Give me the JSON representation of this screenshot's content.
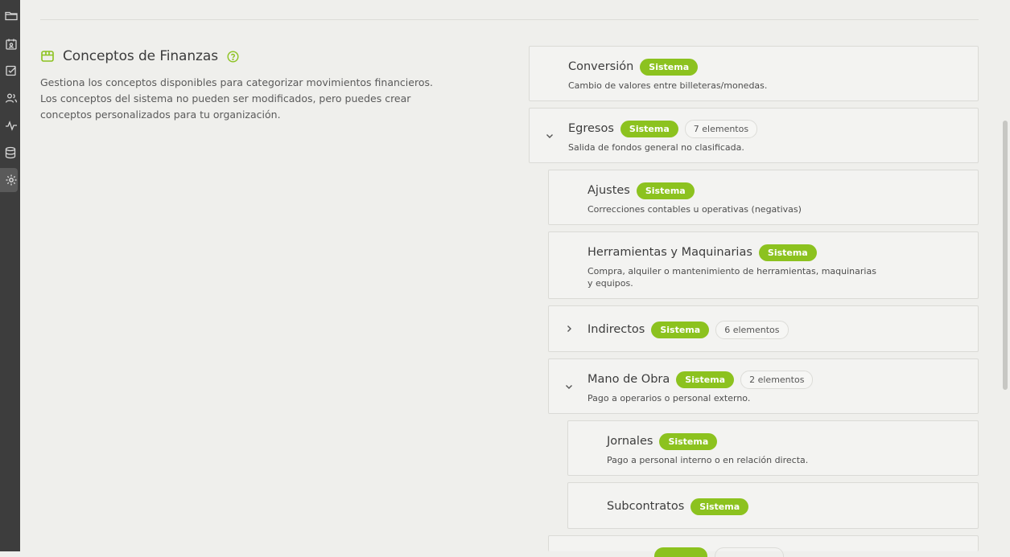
{
  "section": {
    "title": "Conceptos de Finanzas",
    "description": "Gestiona los conceptos disponibles para categorizar movimientos financieros. Los conceptos del sistema no pueden ser modificados, pero puedes crear conceptos personalizados para tu organización."
  },
  "sidebar": {
    "icons": [
      "folder-icon",
      "calendar-user-icon",
      "checkbox-icon",
      "users-icon",
      "activity-icon",
      "database-icon",
      "gear-icon"
    ]
  },
  "concepts": [
    {
      "name": "Conversión",
      "badge": "Sistema",
      "count": "",
      "description": "Cambio de valores entre billeteras/monedas."
    },
    {
      "name": "Egresos",
      "badge": "Sistema",
      "count": "7 elementos",
      "description": "Salida de fondos general no clasificada."
    },
    {
      "name": "Ajustes",
      "badge": "Sistema",
      "count": "",
      "description": "Correcciones contables u operativas (negativas)"
    },
    {
      "name": "Herramientas y Maquinarias",
      "badge": "Sistema",
      "count": "",
      "description": "Compra, alquiler o mantenimiento de herramientas, maquinarias y equipos."
    },
    {
      "name": "Indirectos",
      "badge": "Sistema",
      "count": "6 elementos",
      "description": ""
    },
    {
      "name": "Mano de Obra",
      "badge": "Sistema",
      "count": "2 elementos",
      "description": "Pago a operarios o personal externo."
    },
    {
      "name": "Jornales",
      "badge": "Sistema",
      "count": "",
      "description": "Pago a personal interno o en relación directa."
    },
    {
      "name": "Subcontratos",
      "badge": "Sistema",
      "count": "",
      "description": ""
    }
  ],
  "colors": {
    "accent": "#8cc21f",
    "background": "#efefec",
    "sidebar": "#3d3d3d"
  }
}
